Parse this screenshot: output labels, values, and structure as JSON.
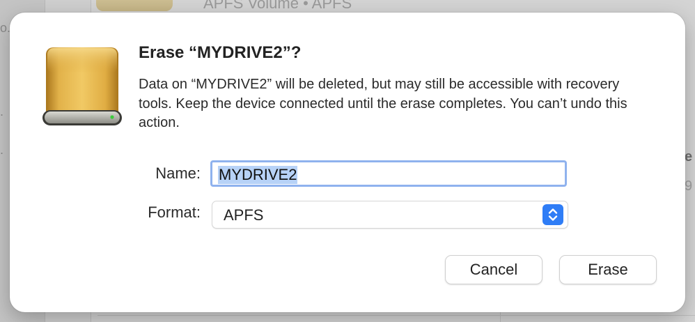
{
  "background": {
    "subtitle": "APFS Volume • APFS",
    "right_text_1": "e",
    "right_text_2": "9",
    "left_dot_1": "o.",
    "left_dot_2": ".",
    "left_dot_3": "."
  },
  "dialog": {
    "title": "Erase “MYDRIVE2”?",
    "message": "Data on “MYDRIVE2” will be deleted, but may still be accessible with recovery tools. Keep the device connected until the erase completes. You can’t undo this action.",
    "name_label": "Name:",
    "name_value": "MYDRIVE2",
    "format_label": "Format:",
    "format_value": "APFS",
    "cancel_label": "Cancel",
    "erase_label": "Erase",
    "icons": {
      "drive": "external-drive-icon",
      "stepper": "updown-chevron-icon"
    }
  },
  "colors": {
    "selection": "#b7d2f7",
    "focus_ring": "#8fb2ee",
    "accent": "#2f7df6",
    "drive_gold": "#d8a33a",
    "drive_led": "#3ccc3c"
  }
}
